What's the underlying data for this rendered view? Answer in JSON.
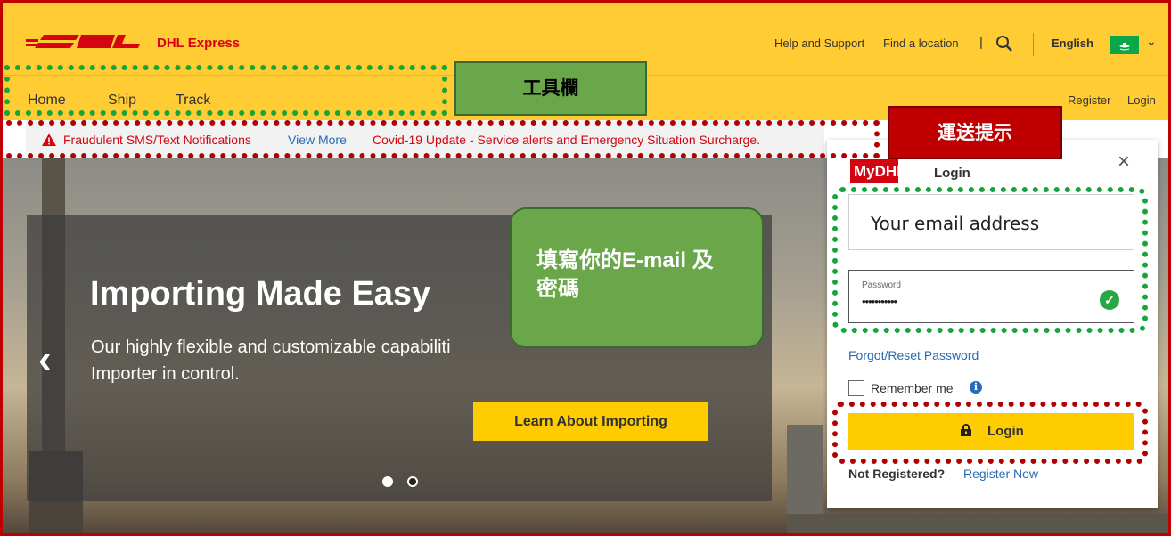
{
  "header": {
    "brand": "DHL Express",
    "help": "Help and Support",
    "find_location": "Find a location",
    "separator": "|",
    "language": "English",
    "flag_chevron": "⌄"
  },
  "nav": {
    "items": [
      "Home",
      "Ship",
      "Track"
    ],
    "register": "Register",
    "login": "Login"
  },
  "notice": {
    "fraud": "Fraudulent SMS/Text Notifications",
    "view_more": "View More",
    "covid": "Covid-19 Update - Service alerts and Emergency Situation Surcharge."
  },
  "hero": {
    "title": "Importing Made Easy",
    "description": "Our highly flexible and customizable capabiliti",
    "description2": "Importer in control.",
    "cta": "Learn About Importing",
    "prev": "‹"
  },
  "login": {
    "logo": "MyDHL",
    "title": "Login",
    "close": "×",
    "email_placeholder": "Your email address",
    "password_label": "Password",
    "password_value": "•••••••••••",
    "forgot": "Forgot/Reset Password",
    "remember": "Remember me",
    "button": "Login",
    "not_registered": "Not Registered?",
    "register_now": "Register Now"
  },
  "annotations": {
    "toolbar": "工具欄",
    "shipping_tips": "運送提示",
    "callout_line1": "填寫你的E-mail 及",
    "callout_line2": "密碼"
  },
  "colors": {
    "dhl_yellow": "#ffcc33",
    "dhl_red": "#d40511",
    "link_blue": "#2a6ab5",
    "annotation_green": "#15a53b",
    "annotation_red": "#b00000"
  }
}
